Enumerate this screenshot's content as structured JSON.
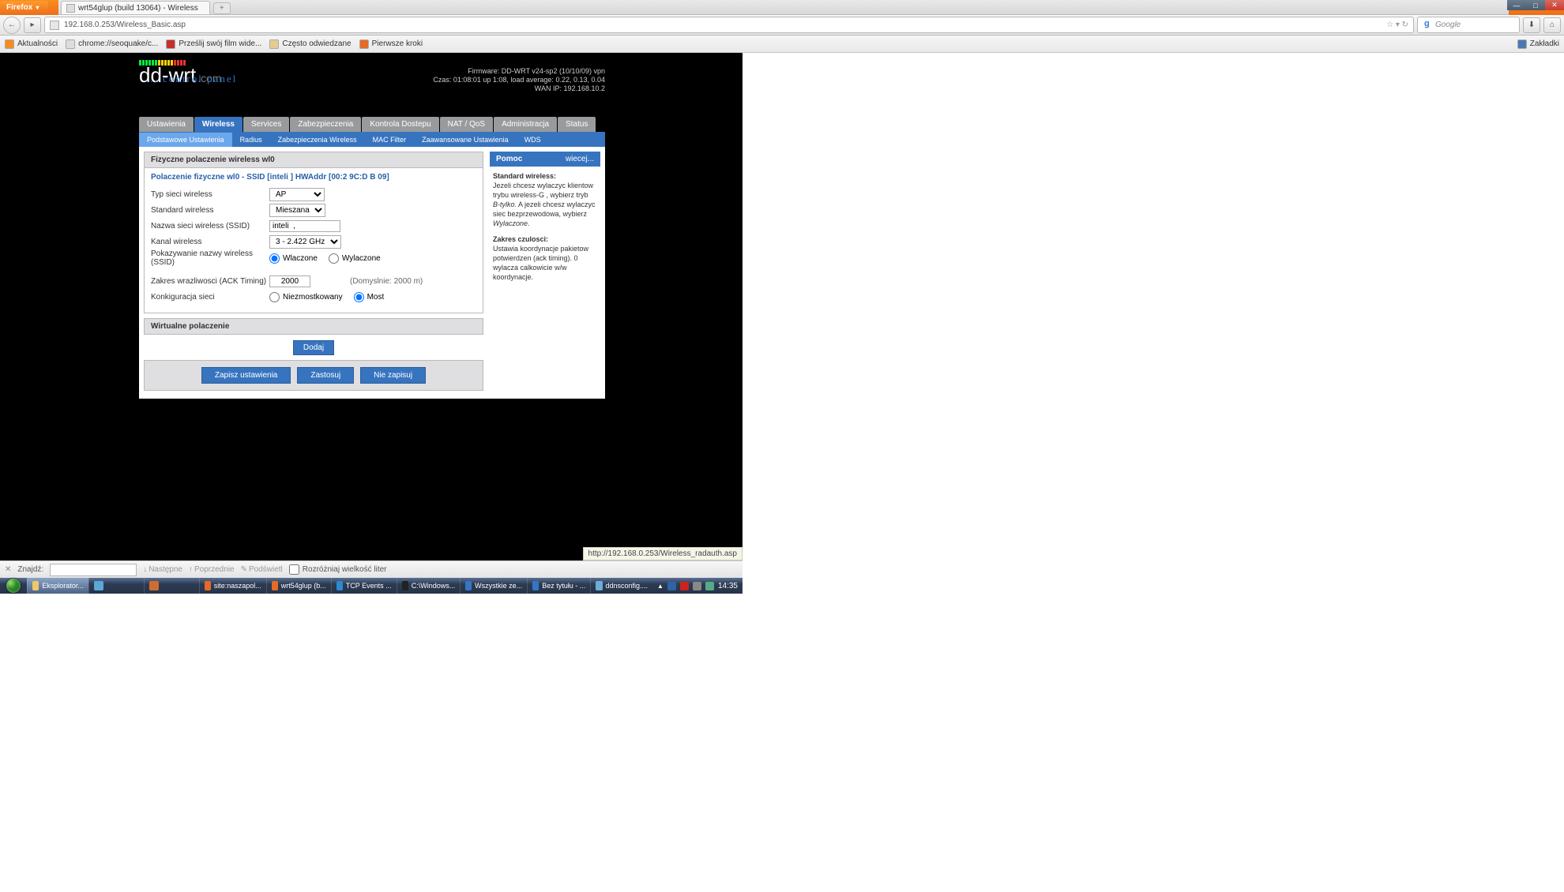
{
  "browser": {
    "app_button": "Firefox",
    "tab_title": "wrt54glup (build 13064) - Wireless",
    "url": "192.168.0.253/Wireless_Basic.asp",
    "search_placeholder": "Google",
    "bookmarks": [
      "Aktualności",
      "chrome://seoquake/c...",
      "Prześlij swój film wide...",
      "Często odwiedzane",
      "Pierwsze kroki"
    ],
    "bookmarks_right": "Zakładki",
    "hover_url": "http://192.168.0.253/Wireless_radauth.asp"
  },
  "router": {
    "stats": {
      "firmware": "Firmware: DD-WRT v24-sp2 (10/10/09) vpn",
      "czas": "Czas: 01:08:01 up 1:08, load average: 0.22, 0.13, 0.04",
      "wanip": "WAN IP: 192.168.10.2"
    },
    "control_panel": "... control panel",
    "maintabs": [
      "Ustawienia",
      "Wireless",
      "Services",
      "Zabezpieczenia",
      "Kontrola Dostepu",
      "NAT / QoS",
      "Administracja",
      "Status"
    ],
    "maintab_active": 1,
    "subtabs": [
      "Podstawowe Ustawienia",
      "Radius",
      "Zabezpieczenia Wireless",
      "MAC Filter",
      "Zaawansowane Ustawienia",
      "WDS"
    ],
    "sec1_title": "Fizyczne polaczenie wireless wl0",
    "conn_title": "Polaczenie fizyczne wl0 - SSID [inteli    ] HWAddr [00:2   9C:D   B   09]",
    "labels": {
      "type": "Typ sieci wireless",
      "std": "Standard wireless",
      "ssid": "Nazwa sieci wireless (SSID)",
      "channel": "Kanal wireless",
      "broadcast": "Pokazywanie nazwy wireless (SSID)",
      "ack": "Zakres wrazliwosci (ACK Timing)",
      "netcfg": "Konkiguracja sieci"
    },
    "values": {
      "type": "AP",
      "std": "Mieszana",
      "ssid": "inteli  ,",
      "channel": "3 - 2.422 GHz",
      "ack": "2000",
      "ack_hint": "(Domyslnie: 2000 m)"
    },
    "radios": {
      "broadcast_on": "Wlaczone",
      "broadcast_off": "Wylaczone",
      "net_unbr": "Niezmostkowany",
      "net_br": "Most"
    },
    "sec2_title": "Wirtualne polaczenie",
    "btn_add": "Dodaj",
    "btn_save": "Zapisz ustawienia",
    "btn_apply": "Zastosuj",
    "btn_cancel": "Nie zapisuj",
    "help": {
      "title": "Pomoc",
      "more": "wiecej...",
      "h1": "Standard wireless:",
      "p1a": "Jezeli chcesz wylaczyc klientow trybu wireless-G , wybierz tryb ",
      "p1em": "B-tylko",
      "p1b": ". A jezeli chcesz wylaczyc siec bezprzewodowa, wybierz ",
      "p1em2": "Wylaczone",
      "h2": "Zakres czulosci:",
      "p2": "Ustawia koordynacje pakietow potwierdzen (ack timing). 0 wylacza calkowicie w/w koordynacje."
    }
  },
  "findbar": {
    "label": "Znajdź:",
    "next": "Następne",
    "prev": "Poprzednie",
    "highlight": "Podświetl",
    "matchcase": "Rozróżniaj wielkość liter"
  },
  "taskbar": {
    "tasks": [
      "Eksplorator...",
      "",
      "",
      "site:naszapol...",
      "wrt54glup (b...",
      "TCP Events ...",
      "C:\\Windows...",
      "Wszystkie ze...",
      "Bez tytułu - ...",
      "ddnsconfig...."
    ],
    "clock": "14:35"
  }
}
